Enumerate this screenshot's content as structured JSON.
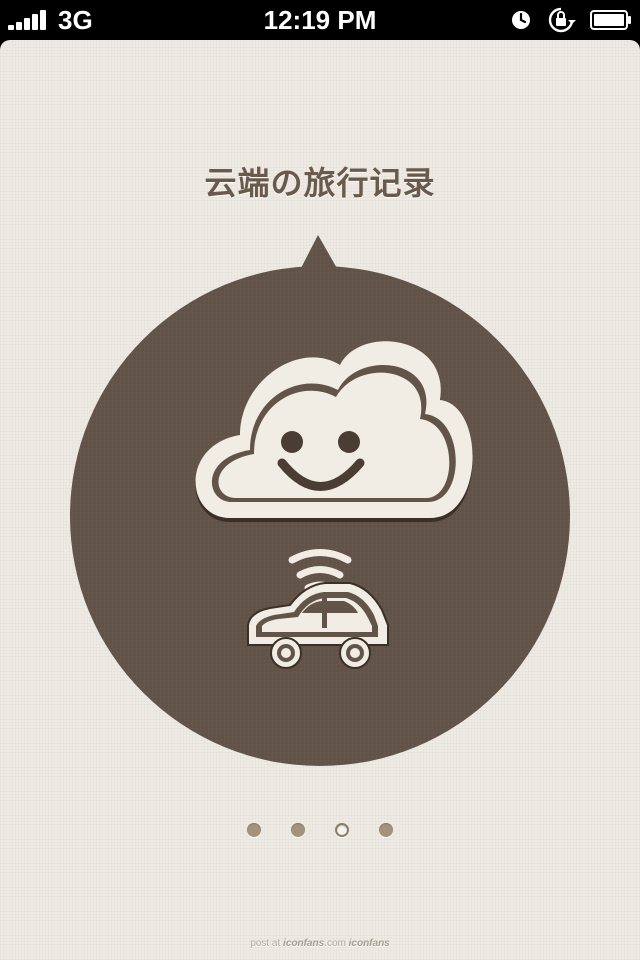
{
  "status_bar": {
    "network": "3G",
    "time": "12:19 PM",
    "signal_bars": 5
  },
  "page": {
    "title": "云端の旅行记录",
    "hero_icons": [
      "cloud-smile-icon",
      "signal-waves-icon",
      "car-icon"
    ],
    "page_count": 4,
    "current_page": 3
  },
  "footer": {
    "credit_prefix": "post at",
    "credit_site": "iconfans",
    "credit_domain": ".com",
    "credit_brand": "iconfans"
  },
  "colors": {
    "background": "#efebe4",
    "circle": "#63544a",
    "title": "#6a5a4c",
    "icon_fill": "#f1ece4",
    "dot": "#a3937d"
  }
}
